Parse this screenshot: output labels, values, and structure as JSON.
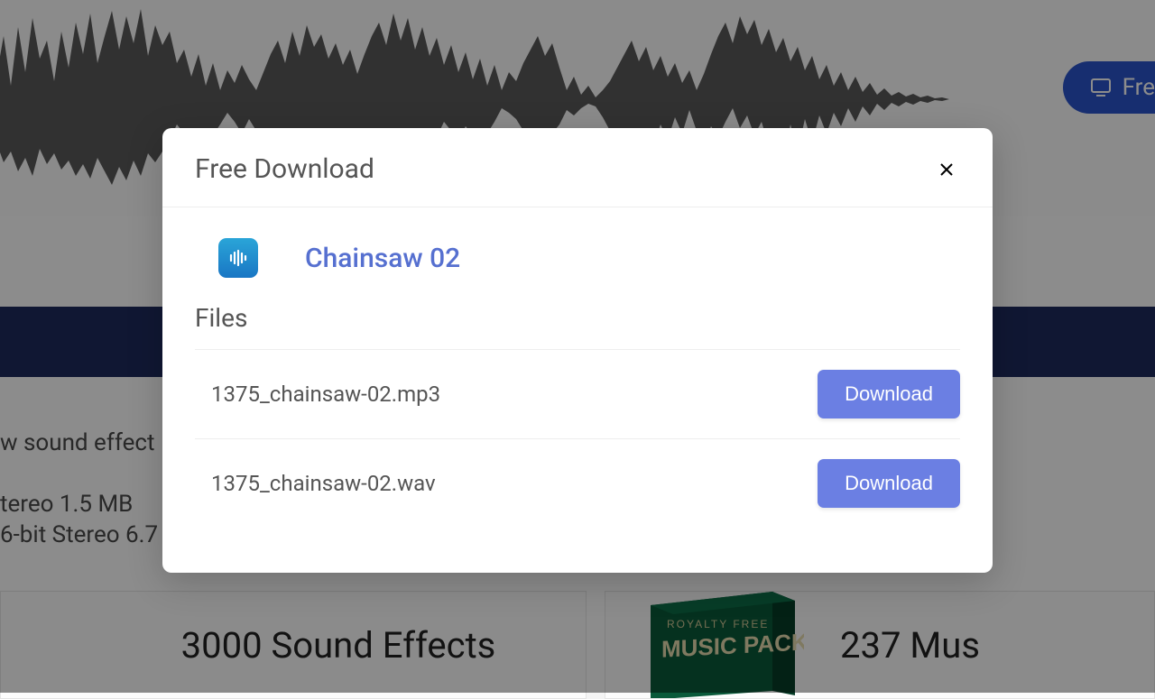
{
  "background": {
    "free_button_label": "Fre",
    "sound_effect_text": "w sound effect",
    "stereo_text_1": "tereo 1.5 MB",
    "stereo_text_2": "6-bit Stereo 6.7",
    "card_left_title": "3000 Sound Effects",
    "card_right_title": "237 Mus",
    "music_pack_label_1": "ROYALTY FREE",
    "music_pack_label_2": "MUSIC PACK"
  },
  "modal": {
    "title": "Free Download",
    "item_title": "Chainsaw 02",
    "files_heading": "Files",
    "files": [
      {
        "name": "1375_chainsaw-02.mp3",
        "button_label": "Download"
      },
      {
        "name": "1375_chainsaw-02.wav",
        "button_label": "Download"
      }
    ]
  }
}
